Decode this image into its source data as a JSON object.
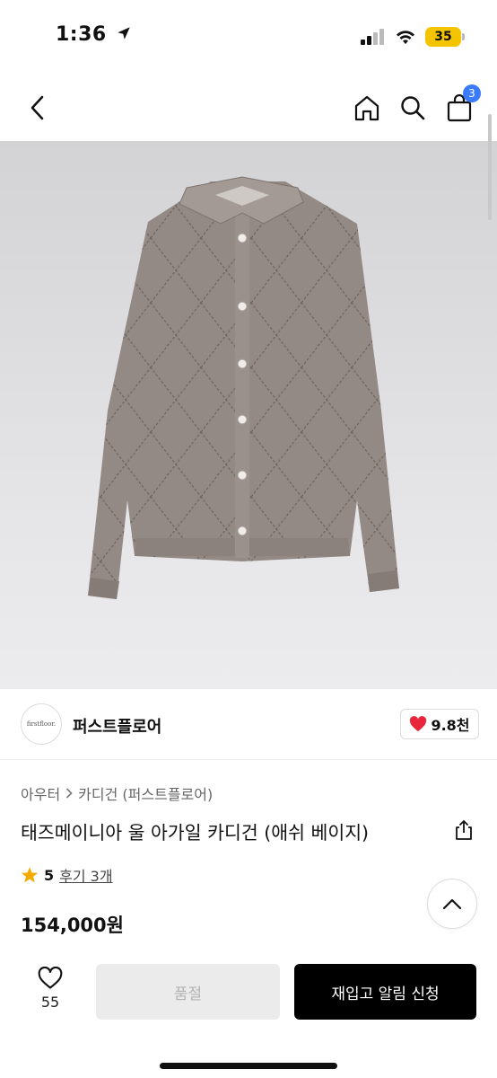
{
  "status_bar": {
    "time": "1:36",
    "battery": "35"
  },
  "nav": {
    "cart_count": "3"
  },
  "brand": {
    "logo_text": "firstfloor.",
    "name": "퍼스트플로어",
    "likes": "9.8천"
  },
  "breadcrumb": {
    "level1": "아우터",
    "level2": "카디건 (퍼스트플로어)"
  },
  "product": {
    "title": "태즈메이니아 울 아가일 카디건 (애쉬 베이지)",
    "rating": "5",
    "reviews": "후기 3개",
    "price": "154,000원"
  },
  "bottom_bar": {
    "wish_count": "55",
    "soldout_label": "품절",
    "restock_label": "재입고 알림 신청"
  },
  "colors": {
    "accent_badge": "#3a7bfd",
    "heart": "#e8263b",
    "star": "#f2a900",
    "primary_button": "#000000"
  }
}
